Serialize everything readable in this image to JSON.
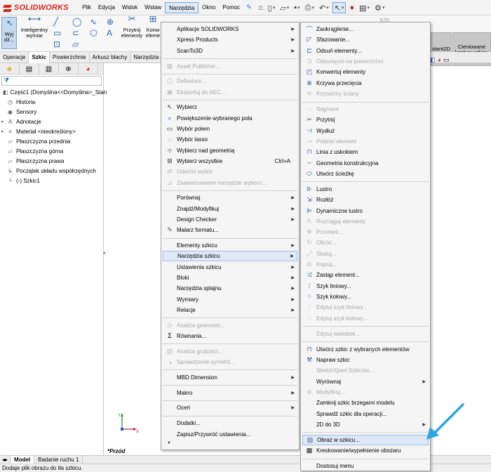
{
  "app": {
    "logo_ds": "DS",
    "logo_text": "SOLIDWORKS"
  },
  "menubar": [
    "Plik",
    "Edycja",
    "Widok",
    "Wstaw",
    "Narzędzia",
    "Okno",
    "Pomoc"
  ],
  "cmd": {
    "select_label": "Wyj dź...",
    "smart_dim": "Inteligentny wymiar",
    "trim": "Przytnij elementy",
    "convert": "Konw eleme",
    "instant2d": "stant2D",
    "shaded": "Cieniowane kontury szkicu",
    "cursor_label": "ЕЛС"
  },
  "tabs": [
    "Operacje",
    "Szkic",
    "Powierzchnie",
    "Arkusz blachy",
    "Narzędzia d"
  ],
  "tree": [
    {
      "label": "Część1  (Domyślna<<Domyślna>_Stan",
      "icon": "part-icon",
      "indent": 0
    },
    {
      "label": "Historia",
      "icon": "history-icon",
      "indent": 1
    },
    {
      "label": "Sensory",
      "icon": "sensor-icon",
      "indent": 1
    },
    {
      "label": "Adnotacje",
      "icon": "annotation-icon",
      "indent": 1
    },
    {
      "label": "Materiał <nieokreślony>",
      "icon": "material-icon",
      "indent": 1
    },
    {
      "label": "Płaszczyzna przednia",
      "icon": "plane-icon",
      "indent": 1
    },
    {
      "label": "Płaszczyzna górna",
      "icon": "plane-icon",
      "indent": 1
    },
    {
      "label": "Płaszczyzna prawa",
      "icon": "plane-icon",
      "indent": 1
    },
    {
      "label": "Początek układu współrzędnych",
      "icon": "origin-icon",
      "indent": 1
    },
    {
      "label": "(-) Szkic1",
      "icon": "sketch-icon",
      "indent": 1
    }
  ],
  "view": {
    "name": "*Przód"
  },
  "bottom_tabs": [
    "Model",
    "Badanie ruchu 1"
  ],
  "status": "Dodaje plik obrazu do tła szkicu.",
  "tools_menu": [
    {
      "label": "Aplikacje SOLIDWORKS",
      "submenu": true
    },
    {
      "label": "Xpress Products",
      "submenu": true
    },
    {
      "label": "ScanTo3D",
      "submenu": true
    },
    {
      "sep": true
    },
    {
      "label": "Asset Publisher...",
      "disabled": true,
      "icon": "asset-icon"
    },
    {
      "sep": true
    },
    {
      "label": "Defeature...",
      "disabled": true,
      "icon": "defeature-icon"
    },
    {
      "label": "Eksportuj do AEC...",
      "disabled": true,
      "icon": "aec-icon"
    },
    {
      "sep": true
    },
    {
      "label": "Wybierz",
      "icon": "cursor-icon"
    },
    {
      "label": "Powiększenie wybranego pola",
      "icon": "magnifier-icon"
    },
    {
      "label": "Wybór polem",
      "icon": "box-select-icon"
    },
    {
      "label": "Wybór lasso",
      "icon": "lasso-icon"
    },
    {
      "label": "Wybierz nad geometrią",
      "icon": "select-over-icon"
    },
    {
      "label": "Wybierz wszystkie",
      "shortcut": "Ctrl+A",
      "icon": "select-all-icon"
    },
    {
      "label": "Odwróć wybór",
      "disabled": true,
      "icon": "invert-icon"
    },
    {
      "label": "Zaawansowane narzędzie wyboru...",
      "disabled": true,
      "icon": "advanced-select-icon"
    },
    {
      "sep": true
    },
    {
      "label": "Porównaj",
      "submenu": true
    },
    {
      "label": "Znajdź/Modyfikuj",
      "submenu": true
    },
    {
      "label": "Design Checker",
      "submenu": true
    },
    {
      "label": "Malarz formatu...",
      "icon": "brush-icon"
    },
    {
      "sep": true
    },
    {
      "label": "Elementy szkicu",
      "submenu": true
    },
    {
      "label": "Narzędzia szkicu",
      "submenu": true,
      "highlight": true
    },
    {
      "label": "Ustawienia szkicu",
      "submenu": true
    },
    {
      "label": "Bloki",
      "submenu": true
    },
    {
      "label": "Narzędzia splajnu",
      "submenu": true
    },
    {
      "label": "Wymiary",
      "submenu": true
    },
    {
      "label": "Relacje",
      "submenu": true
    },
    {
      "sep": true
    },
    {
      "label": "Analiza geometrii...",
      "disabled": true,
      "icon": "analysis-icon"
    },
    {
      "label": "Równania...",
      "icon": "sigma-icon"
    },
    {
      "sep": true
    },
    {
      "label": "Analiza grubości...",
      "disabled": true,
      "icon": "thickness-icon"
    },
    {
      "label": "Sprawdzenie symetrii...",
      "disabled": true,
      "icon": "symmetry-icon"
    },
    {
      "sep": true
    },
    {
      "label": "MBD Dimension",
      "submenu": true
    },
    {
      "sep": true
    },
    {
      "label": "Makro",
      "submenu": true
    },
    {
      "sep": true
    },
    {
      "label": "Oceń",
      "submenu": true
    },
    {
      "sep": true
    },
    {
      "label": "Dodatki..."
    },
    {
      "label": "Zapisz/Przywróć ustawienia..."
    },
    {
      "more": true
    }
  ],
  "sketch_tools_menu": [
    {
      "label": "Zaokrąglenie...",
      "icon": "fillet-icon"
    },
    {
      "label": "Sfazowanie...",
      "icon": "chamfer-icon"
    },
    {
      "label": "Odsuń elementy...",
      "icon": "offset-icon"
    },
    {
      "label": "Odsunięcie na powierzchni",
      "disabled": true,
      "icon": "surface-offset-icon"
    },
    {
      "label": "Konwertuj elementy",
      "icon": "convert-icon"
    },
    {
      "label": "Krzywa przecięcia",
      "icon": "intersection-icon"
    },
    {
      "label": "Krzywizny ściany",
      "disabled": true,
      "icon": "face-curves-icon"
    },
    {
      "sep": true
    },
    {
      "label": "Segment",
      "disabled": true,
      "icon": "segment-icon"
    },
    {
      "label": "Przytnij",
      "icon": "trim-icon"
    },
    {
      "label": "Wydłuż",
      "icon": "extend-icon"
    },
    {
      "label": "Podziel element",
      "disabled": true,
      "icon": "split-icon"
    },
    {
      "label": "Linia z uskokiem",
      "icon": "jog-line-icon"
    },
    {
      "label": "Geometria konstrukcyjna",
      "icon": "construction-icon"
    },
    {
      "label": "Utwórz ścieżkę",
      "icon": "path-icon"
    },
    {
      "sep": true
    },
    {
      "label": "Lustro",
      "icon": "mirror-icon"
    },
    {
      "label": "Rozłóż",
      "icon": "stretch-icon"
    },
    {
      "label": "Dynamiczne lustro",
      "icon": "dynamic-mirror-icon"
    },
    {
      "label": "Rozciągaj elementy",
      "disabled": true,
      "icon": "stretch-entities-icon"
    },
    {
      "label": "Przenieś...",
      "disabled": true,
      "icon": "move-icon"
    },
    {
      "label": "Obróć...",
      "disabled": true,
      "icon": "rotate-icon"
    },
    {
      "label": "Skaluj...",
      "disabled": true,
      "icon": "scale-icon"
    },
    {
      "label": "Kopiuj...",
      "disabled": true,
      "icon": "copy-icon"
    },
    {
      "label": "Zastąp element...",
      "icon": "replace-icon"
    },
    {
      "label": "Szyk liniowy...",
      "icon": "linear-pattern-icon"
    },
    {
      "label": "Szyk kołowy...",
      "icon": "circular-pattern-icon"
    },
    {
      "label": "Edytuj szyk liniowy...",
      "disabled": true,
      "icon": "edit-linear-icon"
    },
    {
      "label": "Edytuj szyk kołowy...",
      "disabled": true,
      "icon": "edit-circular-icon"
    },
    {
      "sep": true
    },
    {
      "label": "Edytuj wielobok...",
      "disabled": true,
      "noicon": true
    },
    {
      "sep": true
    },
    {
      "label": "Utwórz szkic z wybranych elementów",
      "icon": "sketch-from-selection-icon"
    },
    {
      "label": "Napraw szkic",
      "icon": "repair-icon"
    },
    {
      "label": "SketchXpert Szkiców...",
      "disabled": true,
      "noicon": true
    },
    {
      "label": "Wyrównaj",
      "submenu": true,
      "noicon": true
    },
    {
      "label": "Modyfikuj...",
      "disabled": true,
      "icon": "modify-icon"
    },
    {
      "label": "Zamknij szkic brzegami modelu",
      "noicon": true
    },
    {
      "label": "Sprawdź szkic dla operacji...",
      "noicon": true
    },
    {
      "label": "2D do 3D",
      "submenu": true,
      "noicon": true
    },
    {
      "sep": true
    },
    {
      "label": "Obraz w szkicu...",
      "highlight": true,
      "icon": "image-icon"
    },
    {
      "label": "Kreskowanie/wypełnienie obszaru",
      "icon": "hatch-icon"
    },
    {
      "sep": true
    },
    {
      "label": "Dostosuj menu",
      "noicon": true
    }
  ],
  "colors": {
    "highlight": "#dfe8f6",
    "accent_arrow": "#2ba6e0",
    "logo_red": "#d9261c"
  }
}
